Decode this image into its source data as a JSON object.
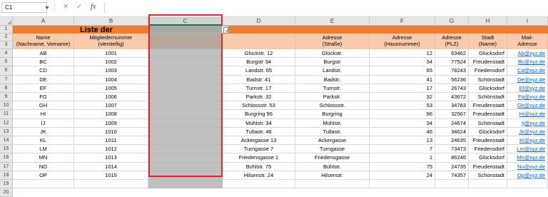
{
  "name_box": "C1",
  "formula_buttons": {
    "cancel": "✕",
    "confirm": "✓",
    "function": "fx"
  },
  "columns": [
    "A",
    "B",
    "C",
    "D",
    "E",
    "F",
    "G",
    "H",
    "I"
  ],
  "selected_column": "C",
  "row_numbers": [
    "1",
    "2",
    "3",
    "4",
    "5",
    "6",
    "7",
    "8",
    "9",
    "10",
    "11",
    "12",
    "13",
    "14",
    "15",
    "16",
    "17",
    "18",
    "19",
    "20"
  ],
  "title": "Liste der Mitglieder",
  "headers": {
    "a": [
      "Name",
      "(Nachname, Vorname)"
    ],
    "b": [
      "Mitgliedernummer",
      "(vierstellig)"
    ],
    "e": [
      "Adresse",
      "(Straße)"
    ],
    "f": [
      "Adresse",
      "(Hausnummer)"
    ],
    "g": [
      "Adresse",
      "(PLZ)"
    ],
    "h": [
      "Stadt",
      "(Name)"
    ],
    "i": [
      "Mail-",
      "Adresse"
    ]
  },
  "rows": [
    [
      "AB",
      "1001",
      "Glückstr. 12",
      "Glückstr.",
      "12",
      "63462",
      "Glücksdorf",
      "Ab@xyz.de"
    ],
    [
      "BC",
      "1002",
      "Burgstr 34",
      "Burgstr",
      "34",
      "77524",
      "Freudenstadt",
      "Bc@xyz.de"
    ],
    [
      "CD",
      "1003",
      "Landstr. 65",
      "Landstr.",
      "65",
      "78243",
      "Friedensdorf",
      "Cd@xyz.de"
    ],
    [
      "DE",
      "1004",
      "Badstr. 41",
      "Badstr.",
      "41",
      "56236",
      "Schönstadt",
      "De@xyz.de"
    ],
    [
      "EF",
      "1005",
      "Turnstr. 17",
      "Turnstr.",
      "17",
      "26743",
      "Glücksdorf",
      "Ef@xyz.de"
    ],
    [
      "FG",
      "1006",
      "Parkstr. 32",
      "Parkstr.",
      "32",
      "43672",
      "Schönstadt",
      "Fg@xyz.de"
    ],
    [
      "GH",
      "1007",
      "Schlossstr. 53",
      "Schlossstr.",
      "53",
      "34783",
      "Freudenstadt",
      "Gh@xyz.de"
    ],
    [
      "HI",
      "1008",
      "Burgring 96",
      "Burgring",
      "96",
      "32567",
      "Freudenstadt",
      "Hi@xyz.de"
    ],
    [
      "IJ",
      "1009",
      "Mühlstr. 34",
      "Mühlstr.",
      "34",
      "24674",
      "Schönstadt",
      "Ij@xyz.de"
    ],
    [
      "JK",
      "1010",
      "Tullastr. 46",
      "Tullastr.",
      "46",
      "34624",
      "Glücksdorf",
      "Jk@xyz.de"
    ],
    [
      "KL",
      "1011",
      "Ackergasse 13",
      "Ackergasse",
      "13",
      "24635",
      "Freudenstadt",
      "Kl@xyz.de"
    ],
    [
      "LM",
      "1012",
      "Turngasse 7",
      "Turngasse",
      "7",
      "73473",
      "Friedensdorf",
      "Lm@xyz.de"
    ],
    [
      "MN",
      "1013",
      "Friedensgasse 1",
      "Friedensgasse",
      "1",
      "86246",
      "Glücksdorf",
      "Mn@xyz.de"
    ],
    [
      "NO",
      "1014",
      "Bühlstr. 75",
      "Bühlstr.",
      "75",
      "24735",
      "Freudenstadt",
      "No@xyz.de"
    ],
    [
      "OP",
      "1015",
      "Hilsenstr. 24",
      "Hilsenstr.",
      "24",
      "74357",
      "Schönstadt",
      "Op@xyz.de"
    ]
  ],
  "colors": {
    "title_fill": "#ed7d31",
    "header_fill": "#f8cbad",
    "selection_fill": "#c0c0c0",
    "selection_outline": "#e0242e",
    "link": "#0563c1"
  }
}
